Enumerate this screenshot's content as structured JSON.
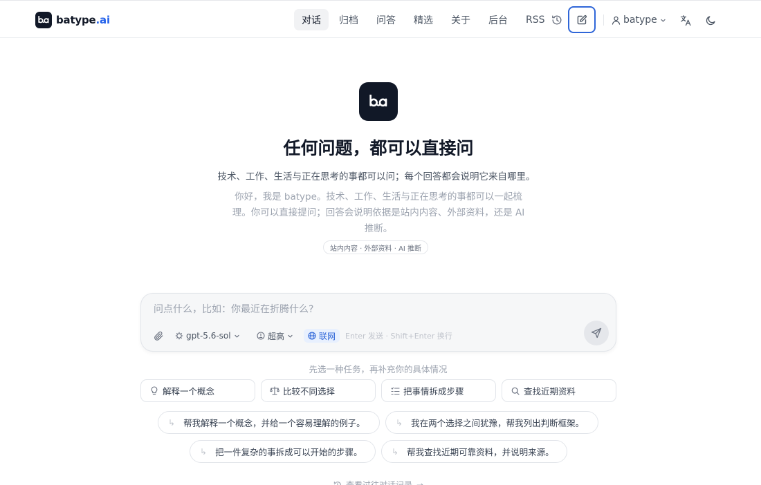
{
  "brand": {
    "name": "batype",
    "suffix": ".ai",
    "logo_text": "ba",
    "accent": "#2563eb"
  },
  "nav": {
    "items": [
      {
        "label": "对话",
        "active": true
      },
      {
        "label": "归档",
        "active": false
      },
      {
        "label": "问答",
        "active": false
      },
      {
        "label": "精选",
        "active": false
      },
      {
        "label": "关于",
        "active": false
      },
      {
        "label": "后台",
        "active": false
      },
      {
        "label": "RSS",
        "active": false
      }
    ],
    "user": "batype",
    "icons": [
      "history-icon",
      "compose-icon",
      "user-icon",
      "chevron-down-icon",
      "translate-icon",
      "moon-icon"
    ]
  },
  "hero": {
    "logo_text": "ba",
    "title": "任何问题，都可以直接问",
    "subtitle": "技术、工作、生活与正在思考的事都可以问；每个回答都会说明它来自哪里。",
    "description_lines": [
      "你好，我是 batype。技术、工作、生活与正在思考的事都可以一起梳",
      "理。你可以直接提问；回答会说明依据是站内内容、外部资料，还是 AI",
      "推断。"
    ],
    "sources_pill": "站内内容 · 外部资料 · AI 推断"
  },
  "composer": {
    "placeholder": "问点什么，比如：你最近在折腾什么?",
    "value": "",
    "model": "gpt-5.6-sol",
    "effort": "超高",
    "web_label": "联网",
    "web_enabled": true,
    "hint": "Enter 发送 · Shift+Enter 换行"
  },
  "tasks": {
    "hint": "先选一种任务，再补充你的具体情况",
    "cards": [
      {
        "label": "解释一个概念",
        "icon": "lightbulb-icon"
      },
      {
        "label": "比较不同选择",
        "icon": "scale-icon"
      },
      {
        "label": "把事情拆成步骤",
        "icon": "list-steps-icon"
      },
      {
        "label": "查找近期资料",
        "icon": "search-icon"
      }
    ],
    "prompts": [
      "帮我解释一个概念，并给一个容易理解的例子。",
      "我在两个选择之间犹豫，帮我列出判断框架。",
      "把一件复杂的事拆成可以开始的步骤。",
      "帮我查找近期可靠资料，并说明来源。"
    ]
  },
  "footer": {
    "history_link": "查看过往对话记录",
    "arrow": "→"
  }
}
